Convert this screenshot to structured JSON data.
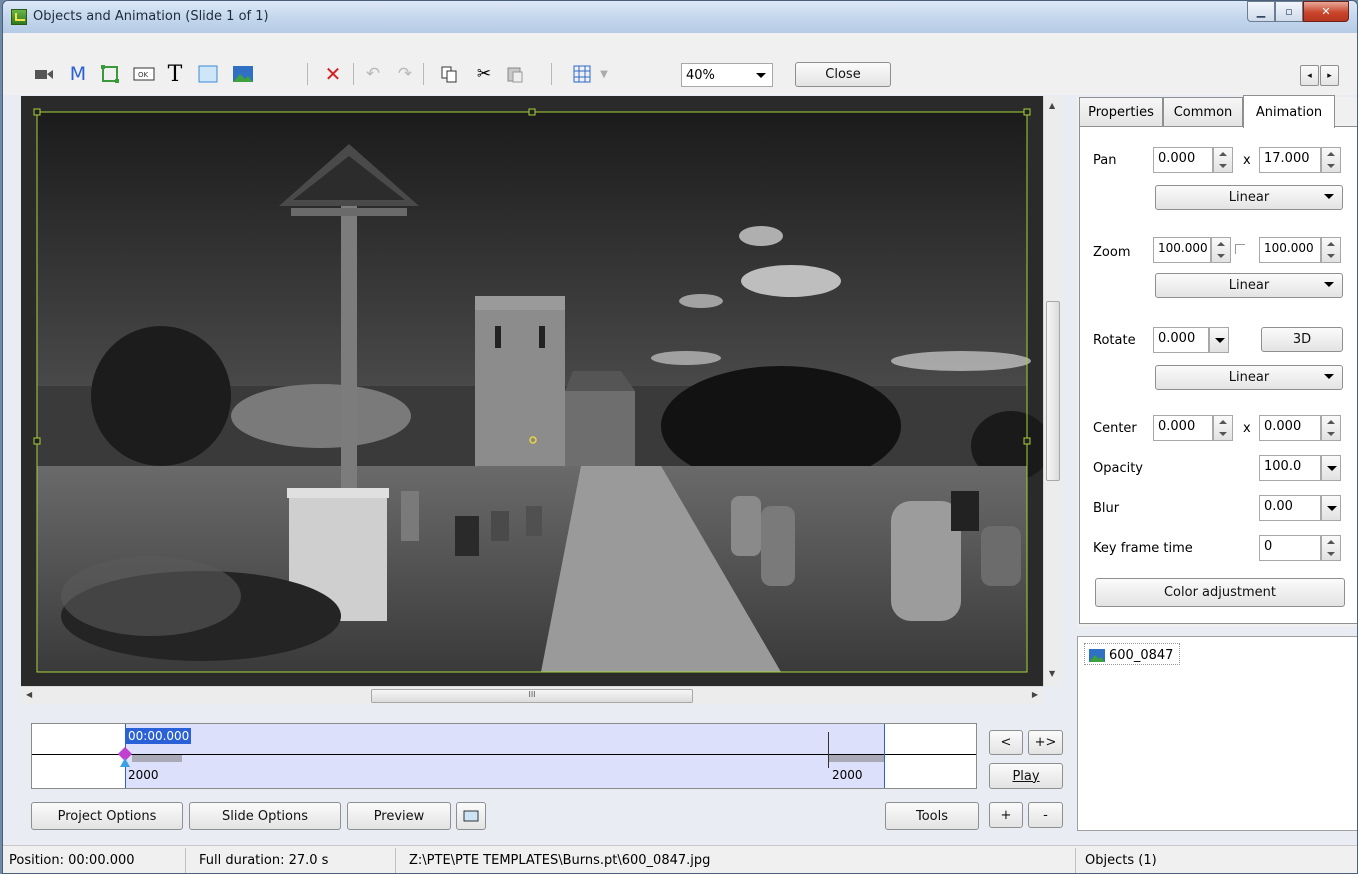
{
  "window": {
    "title": "Objects and Animation  (Slide 1 of 1)"
  },
  "toolbar": {
    "icons": [
      "camera-icon",
      "mask-icon",
      "frame-icon",
      "button-icon",
      "text-icon",
      "rectangle-icon",
      "image-icon",
      "delete-icon",
      "undo-icon",
      "redo-icon",
      "copy-icon",
      "cut-icon",
      "paste-icon",
      "grid-icon"
    ],
    "mask_label": "M",
    "text_label": "T",
    "zoom_value": "40%",
    "close_label": "Close"
  },
  "timeline": {
    "current_time": "00:00.000",
    "start_value": "2000",
    "end_value": "2000",
    "prev_label": "<",
    "next_label": "+>",
    "play_label": "Play",
    "add_label": "+",
    "remove_label": "-"
  },
  "bottom_buttons": {
    "project_options": "Project Options",
    "slide_options": "Slide Options",
    "preview": "Preview",
    "tools": "Tools"
  },
  "tabs": {
    "properties": "Properties",
    "common": "Common",
    "animation": "Animation"
  },
  "animation": {
    "pan_label": "Pan",
    "pan_x": "0.000",
    "pan_sep": "x",
    "pan_y": "17.000",
    "pan_mode": "Linear",
    "zoom_label": "Zoom",
    "zoom_x": "100.000",
    "zoom_y": "100.000",
    "zoom_mode": "Linear",
    "rotate_label": "Rotate",
    "rotate_value": "0.000",
    "three_d_label": "3D",
    "rotate_mode": "Linear",
    "center_label": "Center",
    "center_x": "0.000",
    "center_sep": "x",
    "center_y": "0.000",
    "opacity_label": "Opacity",
    "opacity_value": "100.0",
    "blur_label": "Blur",
    "blur_value": "0.00",
    "keyframe_label": "Key frame time",
    "keyframe_value": "0",
    "color_adjust_label": "Color adjustment"
  },
  "objects": {
    "items": [
      {
        "label": "600_0847"
      }
    ]
  },
  "status": {
    "position": "Position:  00:00.000",
    "duration": "Full duration:  27.0 s",
    "path": "Z:\\PTE\\PTE TEMPLATES\\Burns.pt\\600_0847.jpg",
    "objects": "Objects (1)"
  },
  "scroll_grip": "III",
  "colors": {
    "selection_frame": "#a8d13a",
    "timeline_range": "#dde0fb",
    "accent_blue": "#2a61d6"
  }
}
